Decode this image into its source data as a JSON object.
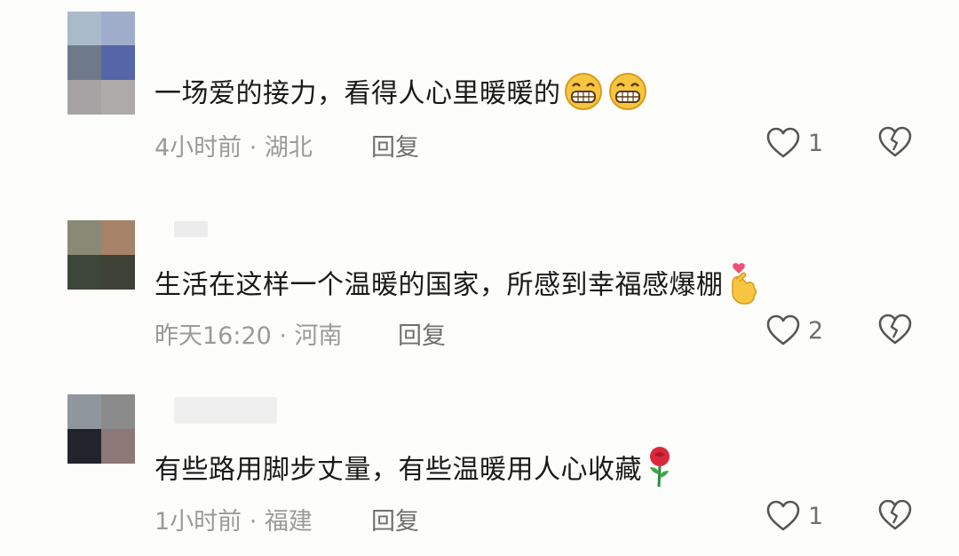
{
  "comments": [
    {
      "text": "一场爱的接力，看得人心里暖暖的",
      "emojis": [
        "grin-icon",
        "grin-icon"
      ],
      "time_location": "4小时前 · 湖北",
      "reply_label": "回复",
      "like_count": "1",
      "avatar_colors": [
        "#a9bacb",
        "#9fadcb",
        "#6e7a8a",
        "#5566a8",
        "#a7a3a5",
        "#adaaa9"
      ]
    },
    {
      "text": "生活在这样一个温暖的国家，所感到幸福感爆棚",
      "emojis": [
        "finger-heart-icon"
      ],
      "time_location": "昨天16:20 · 河南",
      "reply_label": "回复",
      "like_count": "2",
      "avatar_colors": [
        "#898a76",
        "#a58268",
        "#3d4639",
        "#3e4236"
      ]
    },
    {
      "text": "有些路用脚步丈量，有些温暖用人心收藏",
      "emojis": [
        "rose-icon"
      ],
      "time_location": "1小时前 · 福建",
      "reply_label": "回复",
      "like_count": "1",
      "avatar_colors": [
        "#8f969d",
        "#8b8b8b",
        "#23242b",
        "#8d7878"
      ]
    }
  ]
}
